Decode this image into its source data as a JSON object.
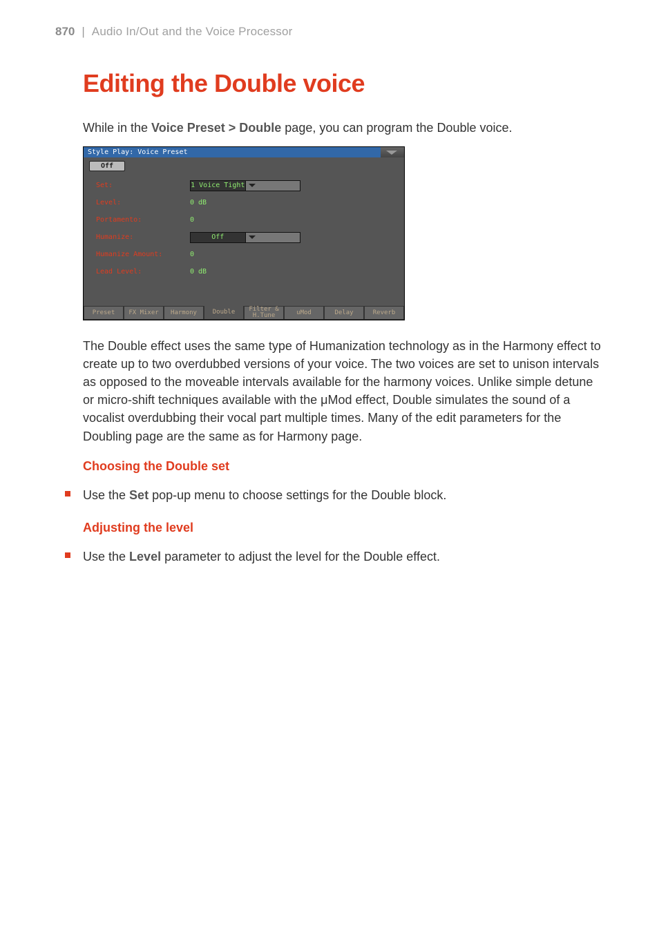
{
  "header": {
    "page_number": "870",
    "separator": "|",
    "section_title": "Audio In/Out and the Voice Processor"
  },
  "title": "Editing the Double voice",
  "intro": {
    "prefix": "While in the ",
    "bold": "Voice Preset > Double",
    "suffix": " page, you can program the Double voice."
  },
  "screenshot": {
    "titlebar": "Style Play: Voice Preset",
    "off_tab": "Off",
    "fields": {
      "set_label": "Set:",
      "set_value": "1 Voice Tight",
      "level_label": "Level:",
      "level_value": "0 dB",
      "portamento_label": "Portamento:",
      "portamento_value": "0",
      "humanize_label": "Humanize:",
      "humanize_value": "Off",
      "humanize_amount_label": "Humanize Amount:",
      "humanize_amount_value": "0",
      "lead_level_label": "Lead Level:",
      "lead_level_value": "0 dB"
    },
    "tabs": [
      "Preset",
      "FX Mixer",
      "Harmony",
      "Double",
      "Filter & H.Tune",
      "uMod",
      "Delay",
      "Reverb"
    ],
    "active_tab_index": 3
  },
  "description": "The Double effect uses the same type of Humanization technology as in the Harmony effect to create up to two overdubbed versions of your voice. The two voices are set to unison intervals as opposed to the moveable intervals available for the harmony voices. Unlike simple detune or micro-shift techniques available with the μMod effect, Double simulates the sound of a vocalist overdubbing their vocal part multiple times. Many of the edit parameters for the Doubling page are the same as for Harmony page.",
  "section_choosing": {
    "heading": "Choosing the Double set",
    "bullet_prefix": "Use the ",
    "bullet_bold": "Set",
    "bullet_suffix": " pop-up menu to choose settings for the Double block."
  },
  "section_level": {
    "heading": "Adjusting the level",
    "bullet_prefix": "Use the ",
    "bullet_bold": "Level",
    "bullet_suffix": " parameter to adjust the level for the Double effect."
  }
}
